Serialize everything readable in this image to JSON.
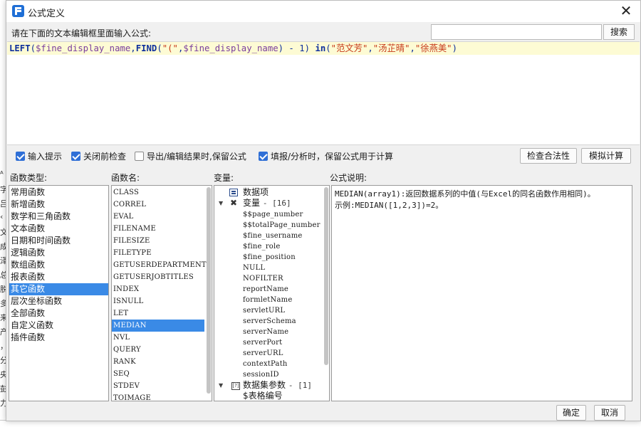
{
  "window": {
    "title": "公式定义",
    "close_glyph": "✕"
  },
  "search": {
    "prompt": "请在下面的文本编辑框里面输入公式:",
    "value": "",
    "placeholder": "",
    "button_label": "搜索"
  },
  "editor": {
    "formula": "LEFT($fine_display_name,FIND(\"(\",$fine_display_name) - 1) in(\"范文芳\",\"汤芷晴\",\"徐燕美\")",
    "tokens": [
      {
        "text": "LEFT",
        "kind": "kw"
      },
      {
        "text": "(",
        "kind": "op"
      },
      {
        "text": "$fine_display_name",
        "kind": "var"
      },
      {
        "text": ",",
        "kind": "op"
      },
      {
        "text": "FIND",
        "kind": "kw"
      },
      {
        "text": "(",
        "kind": "op"
      },
      {
        "text": "\"(\"",
        "kind": "str"
      },
      {
        "text": ",",
        "kind": "op"
      },
      {
        "text": "$fine_display_name",
        "kind": "var"
      },
      {
        "text": ") - 1) ",
        "kind": "op"
      },
      {
        "text": "in",
        "kind": "kw"
      },
      {
        "text": "(",
        "kind": "op"
      },
      {
        "text": "\"范文芳\"",
        "kind": "str"
      },
      {
        "text": ",",
        "kind": "op"
      },
      {
        "text": "\"汤芷晴\"",
        "kind": "str"
      },
      {
        "text": ",",
        "kind": "op"
      },
      {
        "text": "\"徐燕美\"",
        "kind": "str"
      },
      {
        "text": ")",
        "kind": "op"
      }
    ]
  },
  "options": {
    "input_hint": {
      "label": "输入提示",
      "checked": true
    },
    "check_before_close": {
      "label": "关闭前检查",
      "checked": true
    },
    "keep_formula_on_export": {
      "label": "导出/编辑结果时,保留公式",
      "checked": false
    },
    "keep_formula_on_fill": {
      "label": "填报/分析时，保留公式用于计算",
      "checked": true
    },
    "validate_button": "检查合法性",
    "simulate_button": "模拟计算"
  },
  "categories": {
    "label": "函数类型:",
    "selected_index": 8,
    "items": [
      "常用函数",
      "新增函数",
      "数学和三角函数",
      "文本函数",
      "日期和时间函数",
      "逻辑函数",
      "数组函数",
      "报表函数",
      "其它函数",
      "层次坐标函数",
      "全部函数",
      "自定义函数",
      "插件函数"
    ]
  },
  "functions": {
    "label": "函数名:",
    "selected_index": 11,
    "items": [
      "CLASS",
      "CORREL",
      "EVAL",
      "FILENAME",
      "FILESIZE",
      "FILETYPE",
      "GETUSERDEPARTMENTS",
      "GETUSERJOBTITLES",
      "INDEX",
      "ISNULL",
      "LET",
      "MEDIAN",
      "NVL",
      "QUERY",
      "RANK",
      "SEQ",
      "STDEV",
      "TOIMAGE"
    ]
  },
  "variables": {
    "label": "变量:",
    "data_items_label": "数据项",
    "variables_group": {
      "label": "变量",
      "count": "- [16]",
      "expanded": true
    },
    "items": [
      "$$page_number",
      "$$totalPage_number",
      "$fine_username",
      "$fine_role",
      "$fine_position",
      "NULL",
      "NOFILTER",
      "reportName",
      "formletName",
      "servletURL",
      "serverSchema",
      "serverName",
      "serverPort",
      "serverURL",
      "contextPath",
      "sessionID"
    ],
    "dataset_group": {
      "label": "数据集参数",
      "count": "- [1]",
      "expanded": true,
      "icon_text": "[?]"
    },
    "dataset_items": [
      "$表格编号"
    ]
  },
  "description": {
    "label": "公式说明:",
    "line1": "MEDIAN(array1):返回数据系列的中值(与Excel的同名函数作用相同)。",
    "line2": "示例:MEDIAN([1,2,3])=2。"
  },
  "footer": {
    "ok_label": "确定",
    "cancel_label": "取消"
  },
  "backdrop": {
    "left_chars": [
      "ᴬ",
      "字",
      "吕",
      "‹",
      "文",
      "成",
      "泽",
      "总",
      "脱",
      "多",
      "来",
      "产",
      "，",
      "分",
      "央",
      "彭",
      "力"
    ]
  },
  "colors": {
    "accent": "#3a8ae6",
    "editor_highlight": "#fdfbd4",
    "keyword": "#0e2f9c",
    "variable": "#7a3e9d",
    "string": "#c73a1a"
  }
}
